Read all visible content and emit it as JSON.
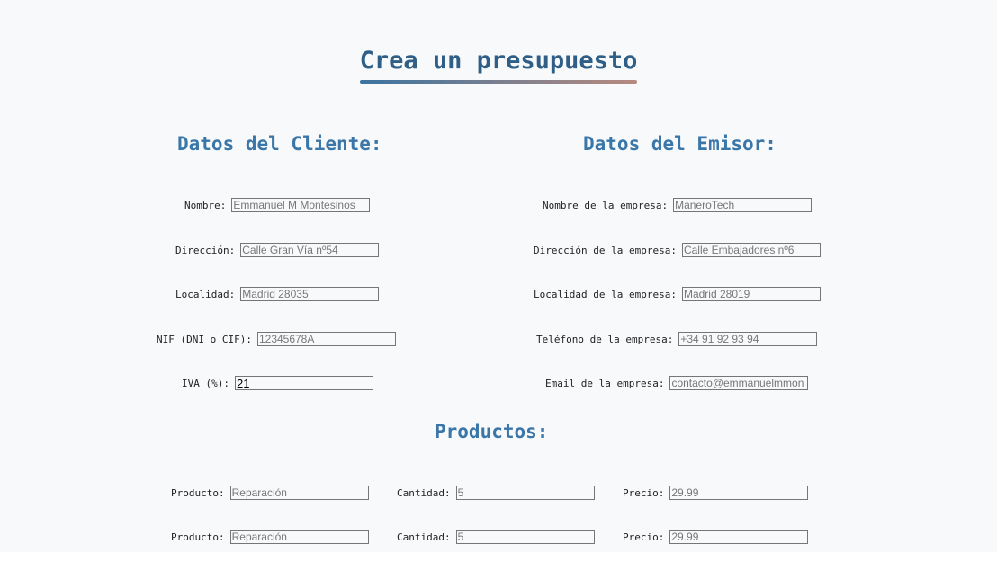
{
  "title": "Crea un presupuesto",
  "cliente": {
    "heading": "Datos del Cliente:",
    "fields": [
      {
        "label": "Nombre:",
        "placeholder": "Emmanuel M Montesinos",
        "value": ""
      },
      {
        "label": "Dirección:",
        "placeholder": "Calle Gran Vía nº54",
        "value": ""
      },
      {
        "label": "Localidad:",
        "placeholder": "Madrid 28035",
        "value": ""
      },
      {
        "label": "NIF (DNI o CIF):",
        "placeholder": "12345678A",
        "value": ""
      },
      {
        "label": "IVA (%):",
        "placeholder": "",
        "value": "21"
      }
    ]
  },
  "emisor": {
    "heading": "Datos del Emisor:",
    "fields": [
      {
        "label": "Nombre de la empresa:",
        "placeholder": "ManeroTech",
        "value": ""
      },
      {
        "label": "Dirección de la empresa:",
        "placeholder": "Calle Embajadores nº6",
        "value": ""
      },
      {
        "label": "Localidad de la empresa:",
        "placeholder": "Madrid 28019",
        "value": ""
      },
      {
        "label": "Teléfono de la empresa:",
        "placeholder": "+34 91 92 93 94",
        "value": ""
      },
      {
        "label": "Email de la empresa:",
        "placeholder": "contacto@emmanuelmmon",
        "value": ""
      }
    ]
  },
  "productos": {
    "heading": "Productos:",
    "rows": [
      {
        "producto_label": "Producto:",
        "producto_placeholder": "Reparación",
        "cantidad_label": "Cantidad:",
        "cantidad_placeholder": "5",
        "precio_label": "Precio:",
        "precio_placeholder": "29.99"
      },
      {
        "producto_label": "Producto:",
        "producto_placeholder": "Reparación",
        "cantidad_label": "Cantidad:",
        "cantidad_placeholder": "5",
        "precio_label": "Precio:",
        "precio_placeholder": "29.99"
      }
    ]
  }
}
